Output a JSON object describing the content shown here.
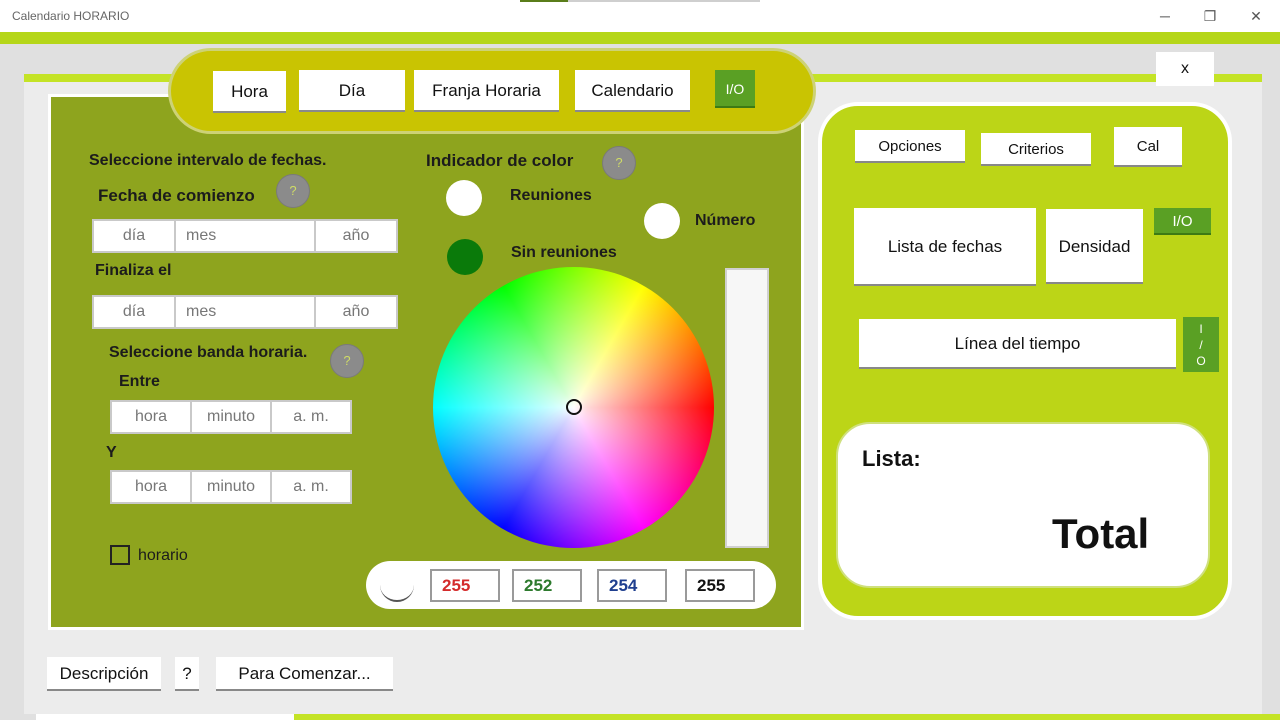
{
  "window": {
    "title": "Calendario HORARIO",
    "minimize": "─",
    "restore": "❐",
    "close": "✕"
  },
  "topnav": {
    "hora": "Hora",
    "dia": "Día",
    "franja": "Franja Horaria",
    "calendario": "Calendario",
    "io": "I/O"
  },
  "close_label": "x",
  "dates": {
    "heading": "Seleccione intervalo de fechas.",
    "start_label": "Fecha de comienzo",
    "end_label": "Finaliza el",
    "day_placeholder": "día",
    "month_placeholder": "mes",
    "year_placeholder": "año",
    "help": "?"
  },
  "timeband": {
    "heading": "Seleccione banda horaria.",
    "between_label": "Entre",
    "and_label": "Y",
    "hour_placeholder": "hora",
    "minute_placeholder": "minuto",
    "ampm": "a. m.",
    "help": "?",
    "schedule_checkbox_label": "horario"
  },
  "color_indicator": {
    "heading": "Indicador de color",
    "help": "?",
    "meetings_label": "Reuniones",
    "no_meetings_label": "Sin reuniones",
    "number_label": "Número",
    "meetings_color": "#ffffff",
    "no_meetings_color": "#0a7a0a",
    "number_color": "#ffffff"
  },
  "color_picker": {
    "r": "255",
    "g": "252",
    "b": "254",
    "a": "255",
    "r_color": "#d42b2b",
    "g_color": "#2d7a2d",
    "b_color": "#1f3f8f"
  },
  "right": {
    "opciones": "Opciones",
    "criterios": "Criterios",
    "cal": "Cal",
    "lista_fechas": "Lista de fechas",
    "densidad": "Densidad",
    "io": "I/O",
    "linea_tiempo": "Línea del tiempo",
    "io_vertical": [
      "I",
      "/",
      "O"
    ],
    "lista_label": "Lista:",
    "total_label": "Total"
  },
  "bottom": {
    "descripcion": "Descripción",
    "help": "?",
    "comenzar": "Para Comenzar..."
  }
}
